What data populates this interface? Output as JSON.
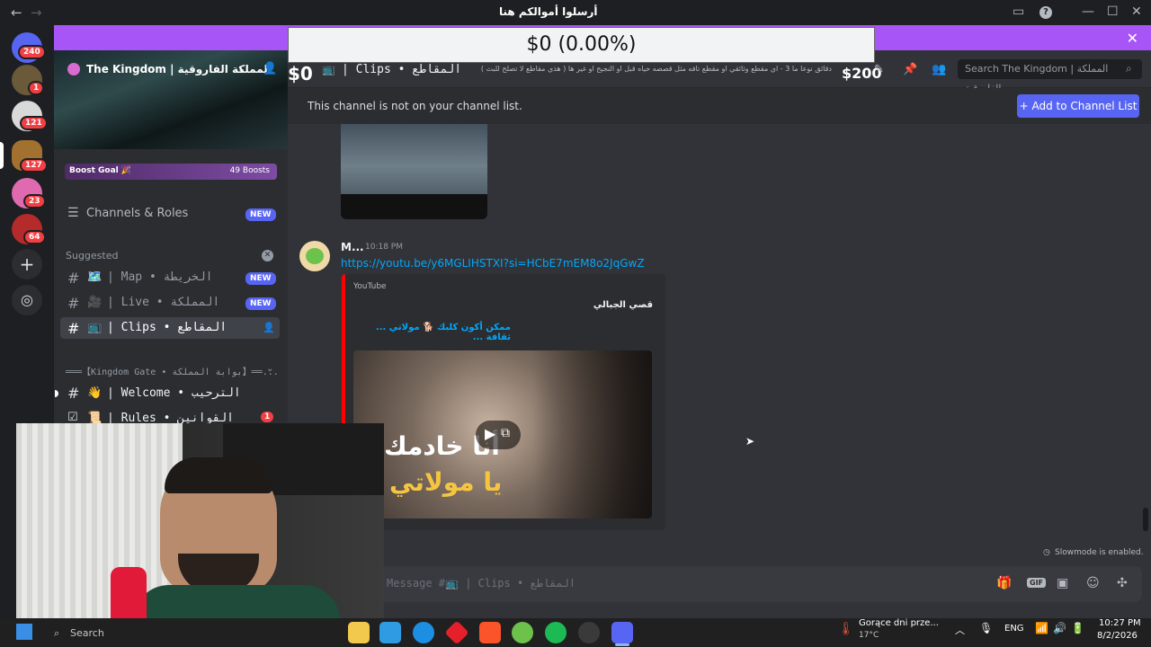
{
  "window": {
    "title": "The Kingdom | المملكة الفاروقية",
    "title_overlay": "أرسلوا أموالكم هنا"
  },
  "rail": {
    "servers": [
      {
        "name": "discord-home",
        "badge": "240"
      },
      {
        "name": "server-1",
        "badge": "1"
      },
      {
        "name": "server-2",
        "badge": "121"
      },
      {
        "name": "server-3",
        "badge": "127"
      },
      {
        "name": "server-4",
        "badge": "23"
      },
      {
        "name": "server-5",
        "badge": "64"
      }
    ]
  },
  "banner": {
    "counter": "$0 (0.00%)",
    "left_amount": "$0",
    "right_amount": "$200"
  },
  "sidebar": {
    "server_name": "The Kingdom | المملكة الفاروقية",
    "boost_goal": "Boost Goal 🎉",
    "boosts": "49 Boosts",
    "channels_roles": "Channels & Roles",
    "new_label": "NEW",
    "suggested": "Suggested",
    "channels": [
      {
        "icon": "🗺️",
        "name": "| Map • الخريطة",
        "new": true
      },
      {
        "icon": "🎥",
        "name": "| Live • المملكة",
        "new": true
      },
      {
        "icon": "📺",
        "name": "| Clips • المقاطع",
        "new": false
      }
    ],
    "category": "═══【Kingdom Gate • بوابة المملكة】══...",
    "cat_channels": [
      {
        "icon": "👋",
        "name": "| Welcome • الترحيب"
      },
      {
        "icon": "📜",
        "name": "| Rules • القوانين",
        "badge": "1"
      }
    ]
  },
  "header": {
    "channel_name": "| Clips • المقاطع",
    "topic": "دقائق نوعا ما 3 - اي مقطع وثائقي او مقطع تافه مثل قصصه حياه قبل او النجيح او غير ها ( هذي مقاطع لا تصلح للبث )",
    "search_placeholder": "Search The Kingdom | المملكة الفاروقية"
  },
  "notice": {
    "text": "This channel is not on your channel list.",
    "button": "+ Add to Channel List"
  },
  "message": {
    "author": "M...",
    "time": "10:18 PM",
    "link": "https://youtu.be/y6MGLIHSTXI?si=HCbE7mEM8o2JqGwZ",
    "embed_provider": "YouTube",
    "embed_author": "قصي الجبالي",
    "embed_title": "ممكن أكون كلبك 🐕 مولاتي ... ثقافة ...",
    "thumb_text_1": "أنا خادمك",
    "thumb_text_2": "يا مولاتي"
  },
  "slowmode": "Slowmode is enabled.",
  "input": {
    "placeholder": "Message #📺 | Clips • المقاطع"
  },
  "taskbar": {
    "search": "Search",
    "weather_title": "Gorące dni prze...",
    "weather_temp": "17°C",
    "lang": "ENG",
    "time": "10:27 PM",
    "date": "8/2/2026"
  }
}
